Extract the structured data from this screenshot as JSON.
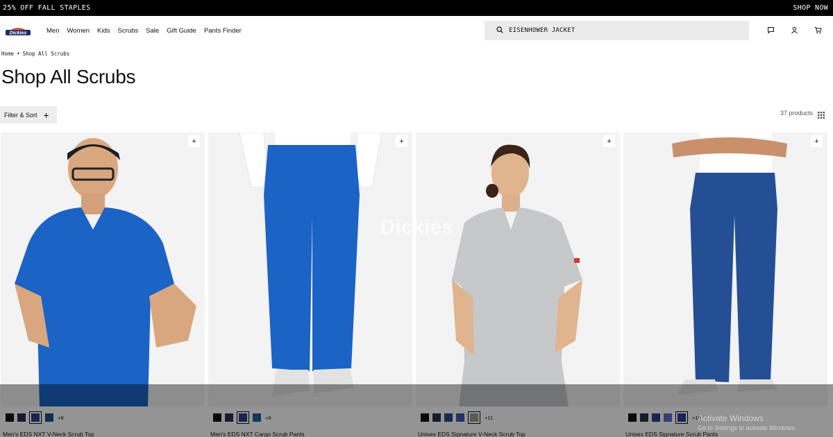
{
  "promo": {
    "left_text": "25% OFF FALL STAPLES",
    "right_text": "SHOP NOW"
  },
  "brand": {
    "logo_text": "Dickies",
    "colors": {
      "accent": "#e4572e",
      "navy": "#1d2a6b"
    }
  },
  "nav": {
    "links": [
      "Men",
      "Women",
      "Kids",
      "Scrubs",
      "Sale",
      "Gift Guide",
      "Pants Finder"
    ]
  },
  "search": {
    "value": "EISENHOWER JACKET"
  },
  "breadcrumb": {
    "home": "Home",
    "sep": "•",
    "current": "Shop All Scrubs"
  },
  "page": {
    "title": "Shop All Scrubs"
  },
  "toolbar": {
    "filter_label": "Filter & Sort",
    "count": "37 products"
  },
  "watermark": "Dickies",
  "products": [
    {
      "name": "Men's EDS NXT V-Neck Scrub Top",
      "swatches": [
        "#111111",
        "#2a2f4d",
        "#2d3f8f",
        "#1f4f8a"
      ],
      "selected": 2,
      "more": "+9",
      "garment_color": "#1b63c4"
    },
    {
      "name": "Men's EDS NXT Cargo Scrub Pants",
      "swatches": [
        "#111111",
        "#2a2f4d",
        "#2d3f8f",
        "#1f5f9a"
      ],
      "selected": 2,
      "more": "+9",
      "garment_color": "#1b63c4"
    },
    {
      "name": "Unisex EDS Signature V-Neck Scrub Top",
      "swatches": [
        "#111111",
        "#2a2f4d",
        "#1f4f8a",
        "#3b56b5",
        "#9a9a9a"
      ],
      "selected": 4,
      "more": "+11",
      "garment_color": "#c6c8ca"
    },
    {
      "name": "Unisex EDS Signature Scrub Pants",
      "swatches": [
        "#111111",
        "#2a2f4d",
        "#2d3f8f",
        "#5b6fc9",
        "#2340a0"
      ],
      "selected": 4,
      "more": "+10",
      "garment_color": "#254f95"
    }
  ],
  "system_notice": {
    "title": "Activate Windows",
    "subtitle": "Go to Settings to activate Windows."
  }
}
